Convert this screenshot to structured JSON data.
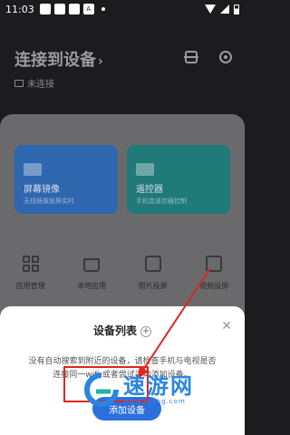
{
  "statusbar": {
    "time": "11:03",
    "badge": "A"
  },
  "header": {
    "title": "连接到设备",
    "chevron": "›",
    "status": "未连接"
  },
  "cards": [
    {
      "title": "屏幕镜像",
      "desc": "无线镜像投屏实时"
    },
    {
      "title": "遥控器",
      "desc": "手机变遥控器控制"
    }
  ],
  "tools": [
    {
      "label": "应用管理"
    },
    {
      "label": "本地应用"
    },
    {
      "label": "照片投屏"
    },
    {
      "label": "视频投屏"
    }
  ],
  "sheet": {
    "title": "设备列表",
    "plus": "+",
    "close": "✕",
    "description": "没有自动搜索到附近的设备，请检查手机与电视是否连接同一wifi 或者尝试手动添加设备。",
    "add_button": "添加设备"
  },
  "watermark": {
    "brand": "速游网",
    "url": "www.sssbg.com"
  },
  "colors": {
    "primary": "#2b6fdc",
    "highlight": "#e0261e"
  }
}
